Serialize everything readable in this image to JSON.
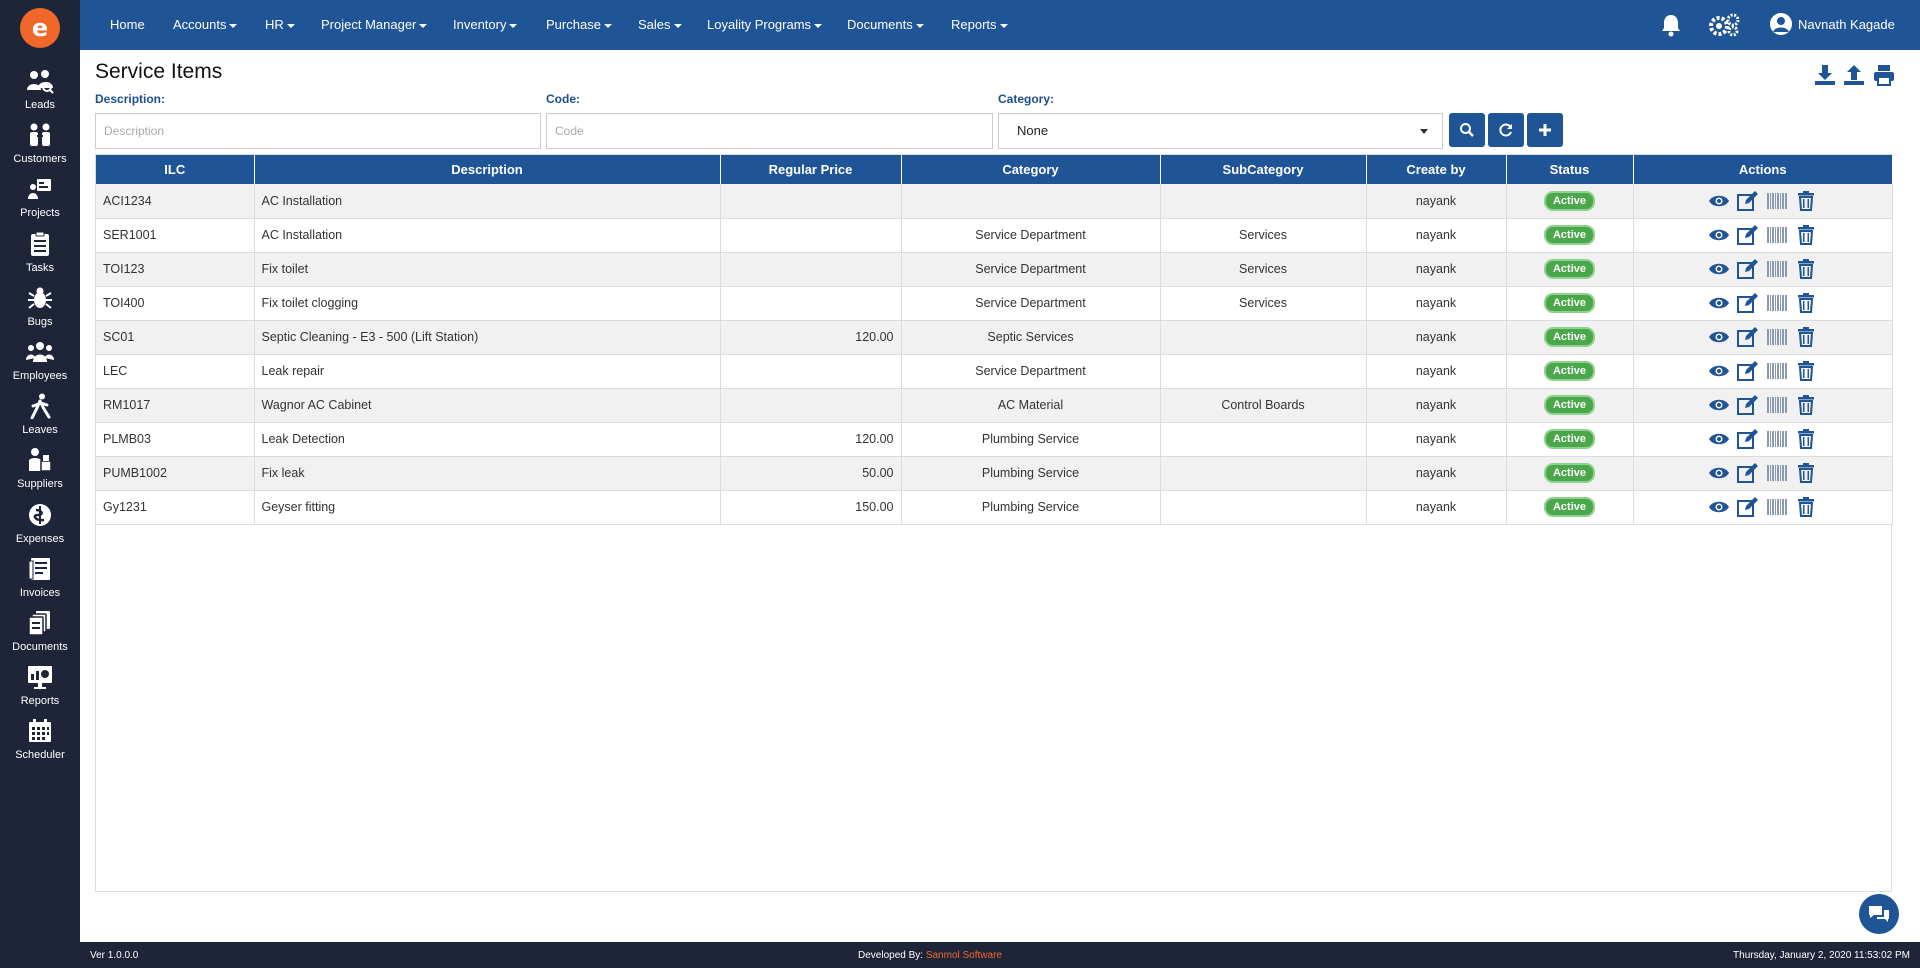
{
  "app": {
    "logo_letter": "e",
    "brand_color": "#f0672a",
    "nav_color": "#1f5496",
    "sidebar_color": "#1e2538"
  },
  "sidebar": {
    "items": [
      {
        "label": "Leads",
        "icon": "leads-icon"
      },
      {
        "label": "Customers",
        "icon": "customers-icon"
      },
      {
        "label": "Projects",
        "icon": "projects-icon"
      },
      {
        "label": "Tasks",
        "icon": "tasks-icon"
      },
      {
        "label": "Bugs",
        "icon": "bug-icon"
      },
      {
        "label": "Employees",
        "icon": "employees-icon"
      },
      {
        "label": "Leaves",
        "icon": "leaves-icon"
      },
      {
        "label": "Suppliers",
        "icon": "suppliers-icon"
      },
      {
        "label": "Expenses",
        "icon": "expenses-icon"
      },
      {
        "label": "Invoices",
        "icon": "invoices-icon"
      },
      {
        "label": "Documents",
        "icon": "documents-icon"
      },
      {
        "label": "Reports",
        "icon": "reports-icon"
      },
      {
        "label": "Scheduler",
        "icon": "calendar-icon"
      }
    ]
  },
  "topnav": {
    "items": [
      "Home",
      "Accounts",
      "HR",
      "Project Manager",
      "Inventory",
      "Purchase",
      "Sales",
      "Loyality Programs",
      "Documents",
      "Reports"
    ],
    "user_name": "Navnath Kagade"
  },
  "page": {
    "title": "Service Items"
  },
  "filters": {
    "description_label": "Description:",
    "description_placeholder": "Description",
    "code_label": "Code:",
    "code_placeholder": "Code",
    "category_label": "Category:",
    "category_value": "None"
  },
  "table": {
    "headers": [
      "ILC",
      "Description",
      "Regular Price",
      "Category",
      "SubCategory",
      "Create by",
      "Status",
      "Actions"
    ],
    "rows": [
      {
        "ilc": "ACI1234",
        "description": "AC Installation",
        "price": "",
        "category": "",
        "subcategory": "",
        "created_by": "nayank",
        "status": "Active"
      },
      {
        "ilc": "SER1001",
        "description": "AC Installation",
        "price": "",
        "category": "Service Department",
        "subcategory": "Services",
        "created_by": "nayank",
        "status": "Active"
      },
      {
        "ilc": "TOI123",
        "description": "Fix toilet",
        "price": "",
        "category": "Service Department",
        "subcategory": "Services",
        "created_by": "nayank",
        "status": "Active"
      },
      {
        "ilc": "TOI400",
        "description": "Fix toilet clogging",
        "price": "",
        "category": "Service Department",
        "subcategory": "Services",
        "created_by": "nayank",
        "status": "Active"
      },
      {
        "ilc": "SC01",
        "description": "Septic Cleaning - E3 - 500 (Lift Station)",
        "price": "120.00",
        "category": "Septic Services",
        "subcategory": "",
        "created_by": "nayank",
        "status": "Active"
      },
      {
        "ilc": "LEC",
        "description": "Leak repair",
        "price": "",
        "category": "Service Department",
        "subcategory": "",
        "created_by": "nayank",
        "status": "Active"
      },
      {
        "ilc": "RM1017",
        "description": "Wagnor AC Cabinet",
        "price": "",
        "category": "AC Material",
        "subcategory": "Control Boards",
        "created_by": "nayank",
        "status": "Active"
      },
      {
        "ilc": "PLMB03",
        "description": "Leak Detection",
        "price": "120.00",
        "category": "Plumbing Service",
        "subcategory": "",
        "created_by": "nayank",
        "status": "Active"
      },
      {
        "ilc": "PUMB1002",
        "description": "Fix leak",
        "price": "50.00",
        "category": "Plumbing Service",
        "subcategory": "",
        "created_by": "nayank",
        "status": "Active"
      },
      {
        "ilc": "Gy1231",
        "description": "Geyser fitting",
        "price": "150.00",
        "category": "Plumbing Service",
        "subcategory": "",
        "created_by": "nayank",
        "status": "Active"
      }
    ]
  },
  "footer": {
    "version": "Ver 1.0.0.0",
    "developed_by": "Developed By:",
    "brand": "Sanmol Software",
    "timestamp": "Thursday, January 2, 2020 11:53:02 PM"
  }
}
